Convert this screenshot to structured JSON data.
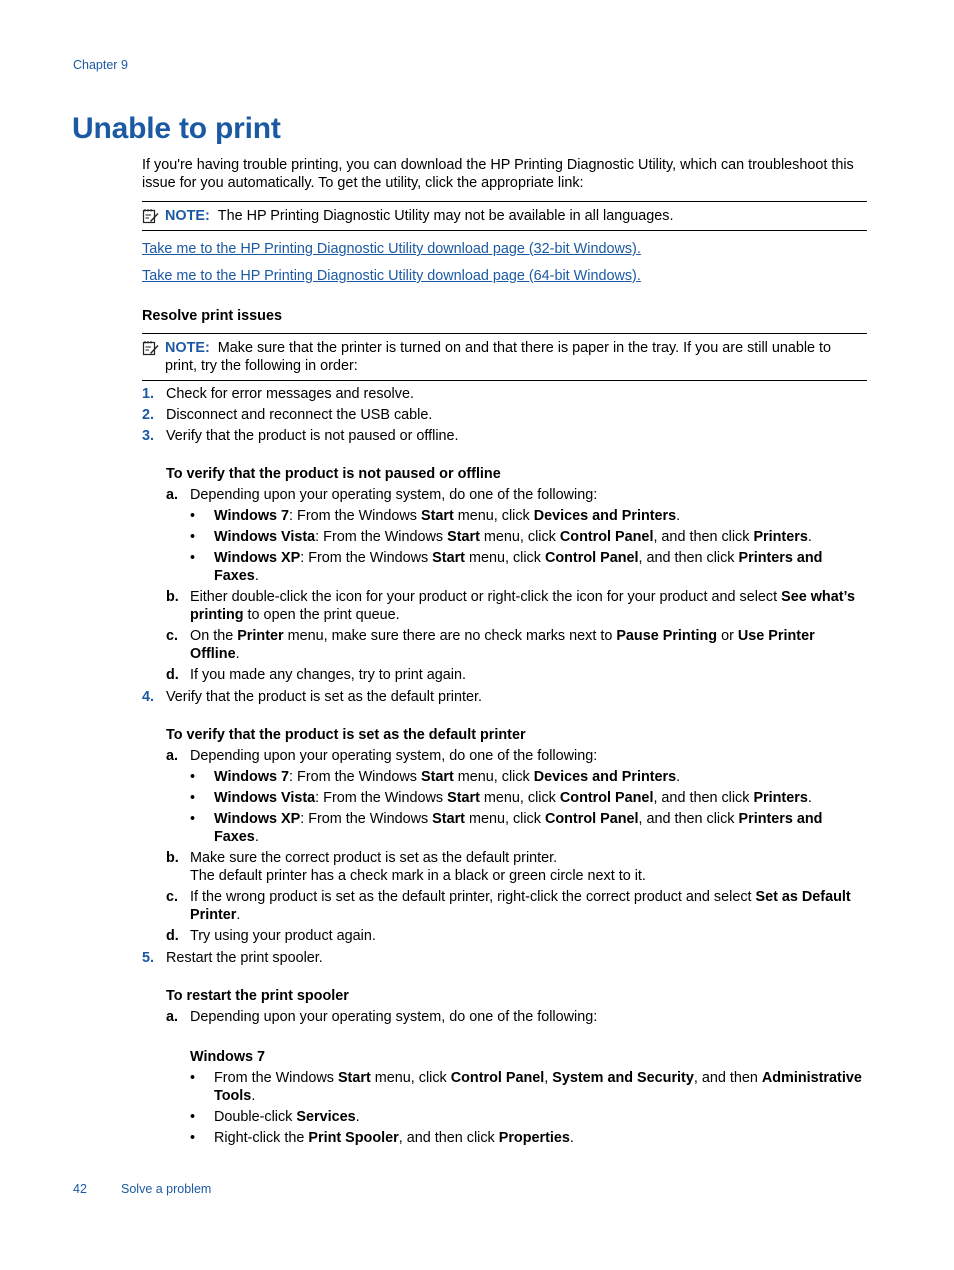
{
  "header": {
    "chapter": "Chapter 9"
  },
  "title": "Unable to print",
  "intro": "If you're having trouble printing, you can download the HP Printing Diagnostic Utility, which can troubleshoot this issue for you automatically. To get the utility, click the appropriate link:",
  "note1": {
    "label": "NOTE:",
    "text": "The HP Printing Diagnostic Utility may not be available in all languages."
  },
  "links": [
    "Take me to the HP Printing Diagnostic Utility download page (32-bit Windows).",
    "Take me to the HP Printing Diagnostic Utility download page (64-bit Windows)."
  ],
  "section": {
    "heading": "Resolve print issues",
    "note": {
      "label": "NOTE:",
      "text": "Make sure that the printer is turned on and that there is paper in the tray. If you are still unable to print, try the following in order:"
    },
    "steps": [
      {
        "num": "1.",
        "text": "Check for error messages and resolve."
      },
      {
        "num": "2.",
        "text": "Disconnect and reconnect the USB cable."
      },
      {
        "num": "3.",
        "text": "Verify that the product is not paused or offline."
      },
      {
        "num": "4.",
        "text": "Verify that the product is set as the default printer."
      },
      {
        "num": "5.",
        "text": "Restart the print spooler."
      }
    ]
  },
  "proc1": {
    "heading": "To verify that the product is not paused or offline",
    "a": {
      "letter": "a",
      "text": "Depending upon your operating system, do one of the following:"
    },
    "bullets": [
      [
        [
          "b",
          "Windows 7"
        ],
        [
          "t",
          ": From the Windows "
        ],
        [
          "b",
          "Start"
        ],
        [
          "t",
          " menu, click "
        ],
        [
          "b",
          "Devices and Printers"
        ],
        [
          "t",
          "."
        ]
      ],
      [
        [
          "b",
          "Windows Vista"
        ],
        [
          "t",
          ": From the Windows "
        ],
        [
          "b",
          "Start"
        ],
        [
          "t",
          " menu, click "
        ],
        [
          "b",
          "Control Panel"
        ],
        [
          "t",
          ", and then click "
        ],
        [
          "b",
          "Printers"
        ],
        [
          "t",
          "."
        ]
      ],
      [
        [
          "b",
          "Windows XP"
        ],
        [
          "t",
          ": From the Windows "
        ],
        [
          "b",
          "Start"
        ],
        [
          "t",
          " menu, click "
        ],
        [
          "b",
          "Control Panel"
        ],
        [
          "t",
          ", and then click "
        ],
        [
          "b",
          "Printers and Faxes"
        ],
        [
          "t",
          "."
        ]
      ]
    ],
    "b": {
      "letter": "b",
      "parts": [
        [
          "t",
          "Either double-click the icon for your product or right-click the icon for your product and select "
        ],
        [
          "b",
          "See what’s printing"
        ],
        [
          "t",
          " to open the print queue."
        ]
      ]
    },
    "c": {
      "letter": "c",
      "parts": [
        [
          "t",
          "On the "
        ],
        [
          "b",
          "Printer"
        ],
        [
          "t",
          " menu, make sure there are no check marks next to "
        ],
        [
          "b",
          "Pause Printing"
        ],
        [
          "t",
          " or "
        ],
        [
          "b",
          "Use Printer Offline"
        ],
        [
          "t",
          "."
        ]
      ]
    },
    "d": {
      "letter": "d",
      "text": "If you made any changes, try to print again."
    }
  },
  "proc2": {
    "heading": "To verify that the product is set as the default printer",
    "a": {
      "letter": "a",
      "text": "Depending upon your operating system, do one of the following:"
    },
    "bullets": [
      [
        [
          "b",
          "Windows 7"
        ],
        [
          "t",
          ": From the Windows "
        ],
        [
          "b",
          "Start"
        ],
        [
          "t",
          " menu, click "
        ],
        [
          "b",
          "Devices and Printers"
        ],
        [
          "t",
          "."
        ]
      ],
      [
        [
          "b",
          "Windows Vista"
        ],
        [
          "t",
          ": From the Windows "
        ],
        [
          "b",
          "Start"
        ],
        [
          "t",
          " menu, click "
        ],
        [
          "b",
          "Control Panel"
        ],
        [
          "t",
          ", and then click "
        ],
        [
          "b",
          "Printers"
        ],
        [
          "t",
          "."
        ]
      ],
      [
        [
          "b",
          "Windows XP"
        ],
        [
          "t",
          ": From the Windows "
        ],
        [
          "b",
          "Start"
        ],
        [
          "t",
          " menu, click "
        ],
        [
          "b",
          "Control Panel"
        ],
        [
          "t",
          ", and then click "
        ],
        [
          "b",
          "Printers and Faxes"
        ],
        [
          "t",
          "."
        ]
      ]
    ],
    "b": {
      "letter": "b",
      "text": "Make sure the correct product is set as the default printer.",
      "text2": "The default printer has a check mark in a black or green circle next to it."
    },
    "c": {
      "letter": "c",
      "parts": [
        [
          "t",
          "If the wrong product is set as the default printer, right-click the correct product and select "
        ],
        [
          "b",
          "Set as Default Printer"
        ],
        [
          "t",
          "."
        ]
      ]
    },
    "d": {
      "letter": "d",
      "text": "Try using your product again."
    }
  },
  "proc3": {
    "heading": "To restart the print spooler",
    "a": {
      "letter": "a",
      "text": "Depending upon your operating system, do one of the following:"
    },
    "os_heading": "Windows 7",
    "bullets": [
      [
        [
          "t",
          "From the Windows "
        ],
        [
          "b",
          "Start"
        ],
        [
          "t",
          " menu, click "
        ],
        [
          "b",
          "Control Panel"
        ],
        [
          "t",
          ", "
        ],
        [
          "b",
          "System and Security"
        ],
        [
          "t",
          ", and then "
        ],
        [
          "b",
          "Administrative Tools"
        ],
        [
          "t",
          "."
        ]
      ],
      [
        [
          "t",
          "Double-click "
        ],
        [
          "b",
          "Services"
        ],
        [
          "t",
          "."
        ]
      ],
      [
        [
          "t",
          "Right-click the "
        ],
        [
          "b",
          "Print Spooler"
        ],
        [
          "t",
          ", and then click "
        ],
        [
          "b",
          "Properties"
        ],
        [
          "t",
          "."
        ]
      ]
    ]
  },
  "footer": {
    "page_number": "42",
    "section": "Solve a problem"
  },
  "icons": {
    "note": "note-pad-pencil-icon",
    "bullet": "•"
  }
}
